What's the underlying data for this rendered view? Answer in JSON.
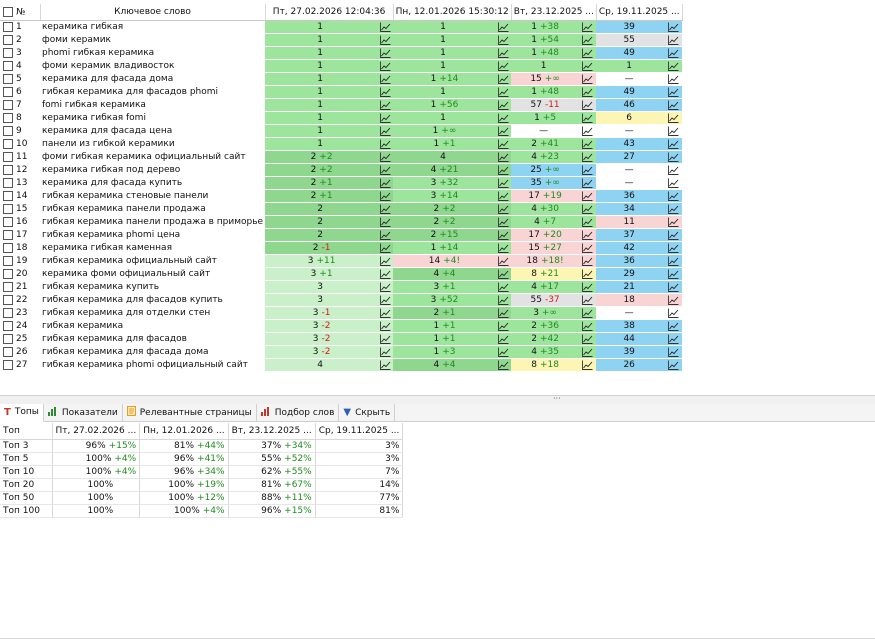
{
  "keywords_table": {
    "headers": {
      "num": "№",
      "keyword": "Ключевое слово",
      "dates": [
        "Пт, 27.02.2026 12:04:36",
        "Пн, 12.01.2026 15:30:12",
        "Вт, 23.12.2025 ...",
        "Ср, 19.11.2025 ..."
      ]
    },
    "rows": [
      {
        "n": "1",
        "kw": "керамика гибкая",
        "c": [
          {
            "v": "1",
            "d": "",
            "t": "",
            "bg": "g"
          },
          {
            "v": "1",
            "d": "",
            "t": "",
            "bg": "g"
          },
          {
            "v": "1",
            "d": "+38",
            "t": "up",
            "bg": "g"
          },
          {
            "v": "39",
            "d": "",
            "t": "",
            "bg": "bl"
          }
        ]
      },
      {
        "n": "2",
        "kw": "фоми керамик",
        "c": [
          {
            "v": "1",
            "d": "",
            "t": "",
            "bg": "g"
          },
          {
            "v": "1",
            "d": "",
            "t": "",
            "bg": "g"
          },
          {
            "v": "1",
            "d": "+54",
            "t": "up",
            "bg": "g"
          },
          {
            "v": "55",
            "d": "",
            "t": "",
            "bg": "gy"
          }
        ]
      },
      {
        "n": "3",
        "kw": "phomi гибкая керамика",
        "c": [
          {
            "v": "1",
            "d": "",
            "t": "",
            "bg": "g"
          },
          {
            "v": "1",
            "d": "",
            "t": "",
            "bg": "g"
          },
          {
            "v": "1",
            "d": "+48",
            "t": "up",
            "bg": "g"
          },
          {
            "v": "49",
            "d": "",
            "t": "",
            "bg": "bl"
          }
        ]
      },
      {
        "n": "4",
        "kw": "фоми керамик владивосток",
        "c": [
          {
            "v": "1",
            "d": "",
            "t": "",
            "bg": "g"
          },
          {
            "v": "1",
            "d": "",
            "t": "",
            "bg": "g"
          },
          {
            "v": "1",
            "d": "",
            "t": "",
            "bg": "g"
          },
          {
            "v": "1",
            "d": "",
            "t": "",
            "bg": "g"
          }
        ]
      },
      {
        "n": "5",
        "kw": "керамика для фасада дома",
        "c": [
          {
            "v": "1",
            "d": "",
            "t": "",
            "bg": "g"
          },
          {
            "v": "1",
            "d": "+14",
            "t": "up",
            "bg": "g"
          },
          {
            "v": "15",
            "d": "+∞",
            "t": "up",
            "bg": "pk"
          },
          {
            "v": "—",
            "d": "",
            "t": "",
            "bg": "wt"
          }
        ]
      },
      {
        "n": "6",
        "kw": "гибкая керамика для фасадов phomi",
        "c": [
          {
            "v": "1",
            "d": "",
            "t": "",
            "bg": "g"
          },
          {
            "v": "1",
            "d": "",
            "t": "",
            "bg": "g"
          },
          {
            "v": "1",
            "d": "+48",
            "t": "up",
            "bg": "g"
          },
          {
            "v": "49",
            "d": "",
            "t": "",
            "bg": "bl"
          }
        ]
      },
      {
        "n": "7",
        "kw": "fomi гибкая керамика",
        "c": [
          {
            "v": "1",
            "d": "",
            "t": "",
            "bg": "g"
          },
          {
            "v": "1",
            "d": "+56",
            "t": "up",
            "bg": "g"
          },
          {
            "v": "57",
            "d": "-11",
            "t": "down",
            "bg": "gy"
          },
          {
            "v": "46",
            "d": "",
            "t": "",
            "bg": "bl"
          }
        ]
      },
      {
        "n": "8",
        "kw": "керамика гибкая fomi",
        "c": [
          {
            "v": "1",
            "d": "",
            "t": "",
            "bg": "g"
          },
          {
            "v": "1",
            "d": "",
            "t": "",
            "bg": "g"
          },
          {
            "v": "1",
            "d": "+5",
            "t": "up",
            "bg": "g"
          },
          {
            "v": "6",
            "d": "",
            "t": "",
            "bg": "yl"
          }
        ]
      },
      {
        "n": "9",
        "kw": "керамика для фасада цена",
        "c": [
          {
            "v": "1",
            "d": "",
            "t": "",
            "bg": "g"
          },
          {
            "v": "1",
            "d": "+∞",
            "t": "up",
            "bg": "g"
          },
          {
            "v": "—",
            "d": "",
            "t": "",
            "bg": "wt"
          },
          {
            "v": "—",
            "d": "",
            "t": "",
            "bg": "wt"
          }
        ]
      },
      {
        "n": "10",
        "kw": "панели из гибкой керамики",
        "c": [
          {
            "v": "1",
            "d": "",
            "t": "",
            "bg": "g"
          },
          {
            "v": "1",
            "d": "+1",
            "t": "up",
            "bg": "g"
          },
          {
            "v": "2",
            "d": "+41",
            "t": "up",
            "bg": "g"
          },
          {
            "v": "43",
            "d": "",
            "t": "",
            "bg": "bl"
          }
        ]
      },
      {
        "n": "11",
        "kw": "фоми гибкая керамика официальный сайт",
        "c": [
          {
            "v": "2",
            "d": "+2",
            "t": "up",
            "bg": "gd"
          },
          {
            "v": "4",
            "d": "",
            "t": "",
            "bg": "gd"
          },
          {
            "v": "4",
            "d": "+23",
            "t": "up",
            "bg": "g"
          },
          {
            "v": "27",
            "d": "",
            "t": "",
            "bg": "bl"
          }
        ]
      },
      {
        "n": "12",
        "kw": "керамика гибкая под дерево",
        "c": [
          {
            "v": "2",
            "d": "+2",
            "t": "up",
            "bg": "gd"
          },
          {
            "v": "4",
            "d": "+21",
            "t": "up",
            "bg": "gd"
          },
          {
            "v": "25",
            "d": "+∞",
            "t": "up",
            "bg": "bl"
          },
          {
            "v": "—",
            "d": "",
            "t": "",
            "bg": "wt"
          }
        ]
      },
      {
        "n": "13",
        "kw": "керамика для фасада купить",
        "c": [
          {
            "v": "2",
            "d": "+1",
            "t": "up",
            "bg": "gd"
          },
          {
            "v": "3",
            "d": "+32",
            "t": "up",
            "bg": "g"
          },
          {
            "v": "35",
            "d": "+∞",
            "t": "up",
            "bg": "bl"
          },
          {
            "v": "—",
            "d": "",
            "t": "",
            "bg": "wt"
          }
        ]
      },
      {
        "n": "14",
        "kw": "гибкая керамика стеновые панели",
        "c": [
          {
            "v": "2",
            "d": "+1",
            "t": "up",
            "bg": "gd"
          },
          {
            "v": "3",
            "d": "+14",
            "t": "up",
            "bg": "g"
          },
          {
            "v": "17",
            "d": "+19",
            "t": "up",
            "bg": "pk"
          },
          {
            "v": "36",
            "d": "",
            "t": "",
            "bg": "bl"
          }
        ]
      },
      {
        "n": "15",
        "kw": "гибкая керамика панели продажа",
        "c": [
          {
            "v": "2",
            "d": "",
            "t": "",
            "bg": "gd"
          },
          {
            "v": "2",
            "d": "+2",
            "t": "up",
            "bg": "gd"
          },
          {
            "v": "4",
            "d": "+30",
            "t": "up",
            "bg": "g"
          },
          {
            "v": "34",
            "d": "",
            "t": "",
            "bg": "bl"
          }
        ]
      },
      {
        "n": "16",
        "kw": "гибкая керамика панели продажа в приморье",
        "c": [
          {
            "v": "2",
            "d": "",
            "t": "",
            "bg": "gd"
          },
          {
            "v": "2",
            "d": "+2",
            "t": "up",
            "bg": "gd"
          },
          {
            "v": "4",
            "d": "+7",
            "t": "up",
            "bg": "g"
          },
          {
            "v": "11",
            "d": "",
            "t": "",
            "bg": "pk"
          }
        ]
      },
      {
        "n": "17",
        "kw": "гибкая керамика phomi цена",
        "c": [
          {
            "v": "2",
            "d": "",
            "t": "",
            "bg": "gd"
          },
          {
            "v": "2",
            "d": "+15",
            "t": "up",
            "bg": "gd"
          },
          {
            "v": "17",
            "d": "+20",
            "t": "up",
            "bg": "pk"
          },
          {
            "v": "37",
            "d": "",
            "t": "",
            "bg": "bl"
          }
        ]
      },
      {
        "n": "18",
        "kw": "керамика гибкая каменная",
        "c": [
          {
            "v": "2",
            "d": "-1",
            "t": "down",
            "bg": "gd"
          },
          {
            "v": "1",
            "d": "+14",
            "t": "up",
            "bg": "g"
          },
          {
            "v": "15",
            "d": "+27",
            "t": "up",
            "bg": "pk"
          },
          {
            "v": "42",
            "d": "",
            "t": "",
            "bg": "bl"
          }
        ]
      },
      {
        "n": "19",
        "kw": "гибкая керамика официальный сайт",
        "c": [
          {
            "v": "3",
            "d": "+11",
            "t": "up",
            "bg": "gl"
          },
          {
            "v": "14",
            "d": "+4!",
            "t": "up",
            "bg": "pk"
          },
          {
            "v": "18",
            "d": "+18!",
            "t": "up",
            "bg": "pk"
          },
          {
            "v": "36",
            "d": "",
            "t": "",
            "bg": "bl"
          }
        ]
      },
      {
        "n": "20",
        "kw": "керамика фоми официальный сайт",
        "c": [
          {
            "v": "3",
            "d": "+1",
            "t": "up",
            "bg": "gl"
          },
          {
            "v": "4",
            "d": "+4",
            "t": "up",
            "bg": "gd"
          },
          {
            "v": "8",
            "d": "+21",
            "t": "up",
            "bg": "yl"
          },
          {
            "v": "29",
            "d": "",
            "t": "",
            "bg": "bl"
          }
        ]
      },
      {
        "n": "21",
        "kw": "гибкая керамика купить",
        "c": [
          {
            "v": "3",
            "d": "",
            "t": "",
            "bg": "gl"
          },
          {
            "v": "3",
            "d": "+1",
            "t": "up",
            "bg": "g"
          },
          {
            "v": "4",
            "d": "+17",
            "t": "up",
            "bg": "g"
          },
          {
            "v": "21",
            "d": "",
            "t": "",
            "bg": "bl"
          }
        ]
      },
      {
        "n": "22",
        "kw": "гибкая керамика для фасадов купить",
        "c": [
          {
            "v": "3",
            "d": "",
            "t": "",
            "bg": "gl"
          },
          {
            "v": "3",
            "d": "+52",
            "t": "up",
            "bg": "g"
          },
          {
            "v": "55",
            "d": "-37",
            "t": "down",
            "bg": "gy"
          },
          {
            "v": "18",
            "d": "",
            "t": "",
            "bg": "pk"
          }
        ]
      },
      {
        "n": "23",
        "kw": "гибкая керамика для отделки стен",
        "c": [
          {
            "v": "3",
            "d": "-1",
            "t": "down",
            "bg": "gl"
          },
          {
            "v": "2",
            "d": "+1",
            "t": "up",
            "bg": "gd"
          },
          {
            "v": "3",
            "d": "+∞",
            "t": "up",
            "bg": "g"
          },
          {
            "v": "—",
            "d": "",
            "t": "",
            "bg": "wt"
          }
        ]
      },
      {
        "n": "24",
        "kw": "гибкая керамика",
        "c": [
          {
            "v": "3",
            "d": "-2",
            "t": "down",
            "bg": "gl"
          },
          {
            "v": "1",
            "d": "+1",
            "t": "up",
            "bg": "g"
          },
          {
            "v": "2",
            "d": "+36",
            "t": "up",
            "bg": "g"
          },
          {
            "v": "38",
            "d": "",
            "t": "",
            "bg": "bl"
          }
        ]
      },
      {
        "n": "25",
        "kw": "гибкая керамика для фасадов",
        "c": [
          {
            "v": "3",
            "d": "-2",
            "t": "down",
            "bg": "gl"
          },
          {
            "v": "1",
            "d": "+1",
            "t": "up",
            "bg": "g"
          },
          {
            "v": "2",
            "d": "+42",
            "t": "up",
            "bg": "g"
          },
          {
            "v": "44",
            "d": "",
            "t": "",
            "bg": "bl"
          }
        ]
      },
      {
        "n": "26",
        "kw": "гибкая керамика для фасада дома",
        "c": [
          {
            "v": "3",
            "d": "-2",
            "t": "down",
            "bg": "gl"
          },
          {
            "v": "1",
            "d": "+3",
            "t": "up",
            "bg": "g"
          },
          {
            "v": "4",
            "d": "+35",
            "t": "up",
            "bg": "g"
          },
          {
            "v": "39",
            "d": "",
            "t": "",
            "bg": "bl"
          }
        ]
      },
      {
        "n": "27",
        "kw": "гибкая керамика phomi официальный сайт",
        "c": [
          {
            "v": "4",
            "d": "",
            "t": "",
            "bg": "gl"
          },
          {
            "v": "4",
            "d": "+4",
            "t": "up",
            "bg": "gd"
          },
          {
            "v": "8",
            "d": "+18",
            "t": "up",
            "bg": "yl"
          },
          {
            "v": "26",
            "d": "",
            "t": "",
            "bg": "bl"
          }
        ]
      }
    ]
  },
  "tabs": [
    {
      "label": "Топы",
      "icon": "T",
      "icon_name": "tops-icon",
      "color": "#c0392b",
      "active": true
    },
    {
      "label": "Показатели",
      "icon": "bar-chart-green-icon",
      "icon_name": "metrics-chart-icon",
      "color": "#2e8b2e",
      "active": false
    },
    {
      "label": "Релевантные страницы",
      "icon": "page-icon",
      "icon_name": "page-icon",
      "color": "#e0a030",
      "active": false
    },
    {
      "label": "Подбор слов",
      "icon": "bar-chart-red-icon",
      "icon_name": "keyword-chart-icon",
      "color": "#c0392b",
      "active": false
    },
    {
      "label": "Скрыть",
      "icon": "▼",
      "icon_name": "hide-arrow-icon",
      "color": "#2a62b8",
      "active": false
    }
  ],
  "tops_table": {
    "headers": [
      "Топ",
      "Пт, 27.02.2026 ...",
      "Пн, 12.01.2026 ...",
      "Вт, 23.12.2025 ...",
      "Ср, 19.11.2025 ..."
    ],
    "rows": [
      {
        "label": "Топ 3",
        "c": [
          {
            "v": "96%",
            "d": "+15%"
          },
          {
            "v": "81%",
            "d": "+44%"
          },
          {
            "v": "37%",
            "d": "+34%"
          },
          {
            "v": "3%",
            "d": ""
          }
        ]
      },
      {
        "label": "Топ 5",
        "c": [
          {
            "v": "100%",
            "d": "+4%"
          },
          {
            "v": "96%",
            "d": "+41%"
          },
          {
            "v": "55%",
            "d": "+52%"
          },
          {
            "v": "3%",
            "d": ""
          }
        ]
      },
      {
        "label": "Топ 10",
        "c": [
          {
            "v": "100%",
            "d": "+4%"
          },
          {
            "v": "96%",
            "d": "+34%"
          },
          {
            "v": "62%",
            "d": "+55%"
          },
          {
            "v": "7%",
            "d": ""
          }
        ]
      },
      {
        "label": "Топ 20",
        "c": [
          {
            "v": "100%",
            "d": ""
          },
          {
            "v": "100%",
            "d": "+19%"
          },
          {
            "v": "81%",
            "d": "+67%"
          },
          {
            "v": "14%",
            "d": ""
          }
        ]
      },
      {
        "label": "Топ 50",
        "c": [
          {
            "v": "100%",
            "d": ""
          },
          {
            "v": "100%",
            "d": "+12%"
          },
          {
            "v": "88%",
            "d": "+11%"
          },
          {
            "v": "77%",
            "d": ""
          }
        ]
      },
      {
        "label": "Топ 100",
        "c": [
          {
            "v": "100%",
            "d": ""
          },
          {
            "v": "100%",
            "d": "+4%"
          },
          {
            "v": "96%",
            "d": "+15%"
          },
          {
            "v": "81%",
            "d": ""
          }
        ]
      }
    ]
  },
  "colors": {
    "green": "#9de59d",
    "blue": "#8fd3f2",
    "pink": "#f8d4d4",
    "yellow": "#fdf5b4",
    "up": "#1f8c1f",
    "down": "#d0201a"
  }
}
